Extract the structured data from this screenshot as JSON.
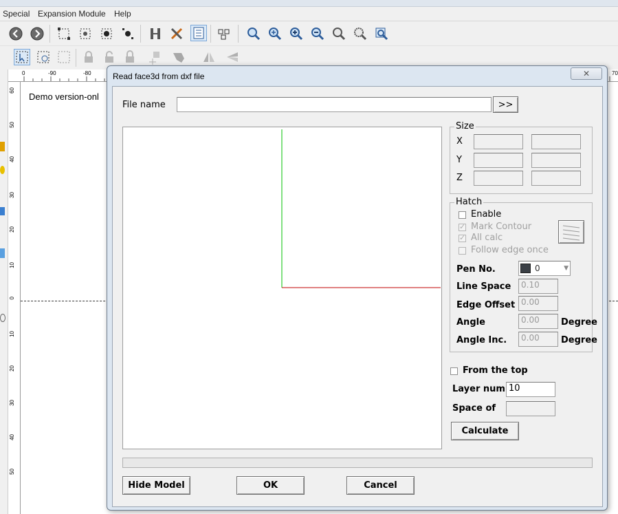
{
  "app": {
    "menu": [
      "Special",
      "Expansion Module",
      "Help"
    ],
    "demo_text": "Demo version-onl",
    "ruler_top": [
      "0",
      "-90",
      "-80",
      "70"
    ],
    "ruler_left": [
      "60",
      "50",
      "40",
      "30",
      "20",
      "10",
      "0",
      "10",
      "20",
      "30",
      "40",
      "50"
    ]
  },
  "dialog": {
    "title": "Read face3d from dxf file",
    "file_name_label": "File name",
    "file_name_value": "",
    "browse_label": ">>",
    "size": {
      "title": "Size",
      "axes": [
        "X",
        "Y",
        "Z"
      ]
    },
    "hatch": {
      "title": "Hatch",
      "enable_label": "Enable",
      "enable_checked": false,
      "mark_contour_label": "Mark Contour",
      "mark_contour_checked": true,
      "all_calc_label": "All calc",
      "all_calc_checked": true,
      "follow_edge_label": "Follow edge once",
      "follow_edge_checked": false,
      "pen_no_label": "Pen No.",
      "pen_no_value": "0",
      "pen_color": "#3a3f45",
      "line_space_label": "Line Space",
      "line_space_value": "0.10",
      "edge_offset_label": "Edge Offset",
      "edge_offset_value": "0.00",
      "angle_label": "Angle",
      "angle_value": "0.00",
      "angle_unit": "Degree",
      "angle_inc_label": "Angle Inc.",
      "angle_inc_value": "0.00",
      "angle_inc_unit": "Degree"
    },
    "from_top_label": "From the top",
    "from_top_checked": false,
    "layer_num_label": "Layer num",
    "layer_num_value": "10",
    "space_of_label": "Space of",
    "space_of_value": "",
    "calculate_label": "Calculate",
    "hide_model_label": "Hide Model",
    "ok_label": "OK",
    "cancel_label": "Cancel",
    "close_icon": "close-x",
    "axis_colors": {
      "y_axis": "#00c000",
      "x_axis": "#c00000"
    }
  }
}
